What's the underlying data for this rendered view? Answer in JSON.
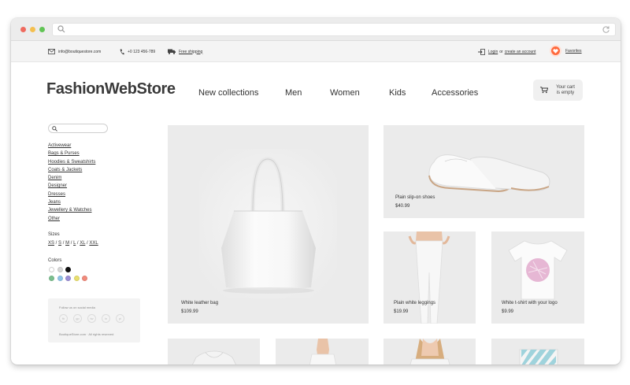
{
  "browser": {
    "icons": [
      "search-icon",
      "refresh-icon"
    ]
  },
  "infobar": {
    "email": "info@boutiquestore.com",
    "phone": "+0 123 456-789",
    "shipping": "Free shipping",
    "login": "Login",
    "login_or": "or",
    "create_account": "create an account",
    "favorites": "Favorites"
  },
  "header": {
    "logo": "FashionWebStore",
    "nav": [
      "New collections",
      "Men",
      "Women",
      "Kids",
      "Accessories"
    ],
    "cart_line1": "Your cart",
    "cart_line2": "is empty"
  },
  "sidebar": {
    "search_placeholder": "",
    "categories": [
      "Activewear",
      "Bags & Purses",
      "Hoodies & Sweatshirts",
      "Coats & Jackets",
      "Denim",
      "Designer",
      "Dresses",
      "Jeans",
      "Jewellery & Watches",
      "Other"
    ],
    "sizes_label": "Sizes",
    "sizes": [
      "XS",
      "S",
      "M",
      "L",
      "XL",
      "XXL"
    ],
    "colors_label": "Colors",
    "colors": [
      "#ffffff",
      "#d6d6d6",
      "#111111",
      "#7bbf8f",
      "#8fc3e6",
      "#9c8fd6",
      "#e9df6f",
      "#f28b7c"
    ],
    "social_title": "Follow us on social media",
    "social_icons": [
      "fb",
      "gp",
      "tw",
      "in",
      "pi"
    ],
    "copyright": "BoutiqueStore.com · All rights reserved"
  },
  "products": [
    {
      "name": "White leather bag",
      "price": "$109.99"
    },
    {
      "name": "Plain slip-on shoes",
      "price": "$40.99"
    },
    {
      "name": "Plain white leggings",
      "price": "$19.99"
    },
    {
      "name": "White t-shirt with your logo",
      "price": "$9.99"
    }
  ],
  "colors": {
    "accent": "#ff6a3d",
    "card_bg": "#ebebeb",
    "chrome_bg": "#ececec"
  }
}
